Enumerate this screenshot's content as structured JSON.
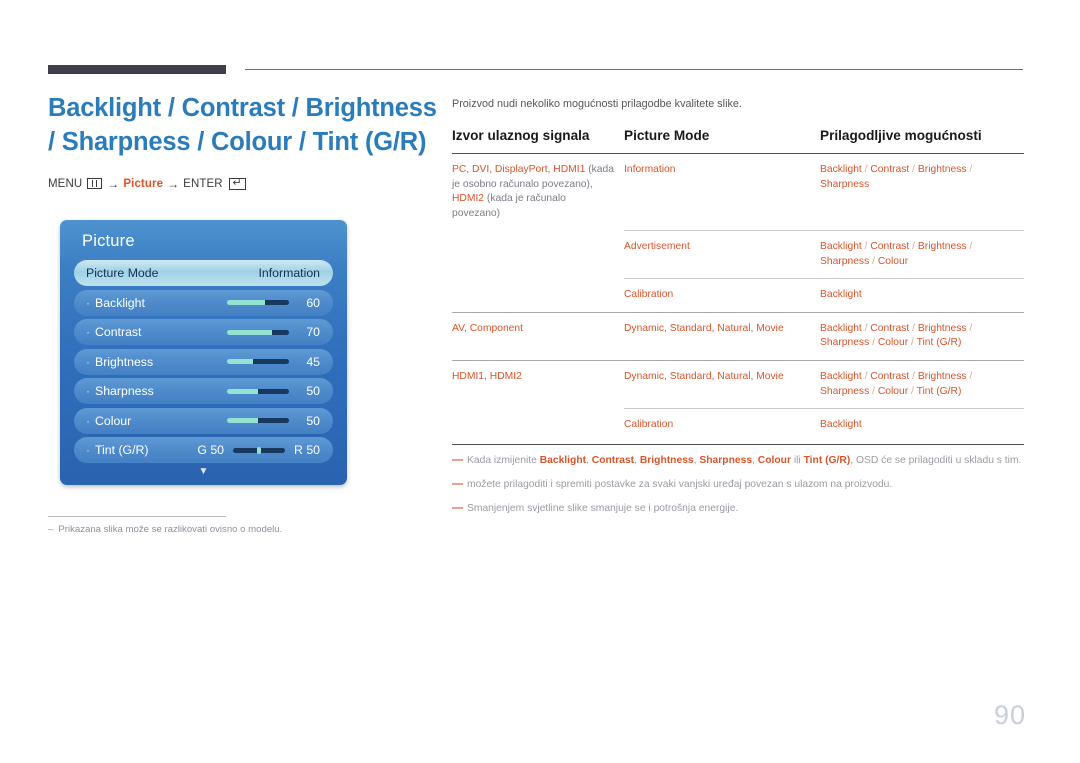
{
  "page": {
    "number": "90"
  },
  "left": {
    "title": "Backlight / Contrast / Brightness / Sharpness / Colour / Tint (G/R)",
    "menu_path": {
      "menu_label": "MENU",
      "menu_icon": "menu-bars-icon",
      "arrow1": "→",
      "target": "Picture",
      "arrow2": "→",
      "enter_label": "ENTER",
      "enter_icon": "enter-key-icon",
      "enter_glyph": "↵"
    },
    "note": {
      "dash": "–",
      "text": "Prikazana slika može se razlikovati ovisno o modelu."
    }
  },
  "osd": {
    "title": "Picture",
    "more_arrow": "▼",
    "bullet": "·",
    "rows": [
      {
        "name": "picture-mode",
        "label": "Picture Mode",
        "value": "Information",
        "type": "select",
        "selected": true
      },
      {
        "name": "backlight",
        "label": "Backlight",
        "value": "60",
        "type": "slider",
        "fill_percent": 62,
        "selected": false
      },
      {
        "name": "contrast",
        "label": "Contrast",
        "value": "70",
        "type": "slider",
        "fill_percent": 72,
        "selected": false
      },
      {
        "name": "brightness",
        "label": "Brightness",
        "value": "45",
        "type": "slider",
        "fill_percent": 42,
        "selected": false
      },
      {
        "name": "sharpness",
        "label": "Sharpness",
        "value": "50",
        "type": "slider",
        "fill_percent": 50,
        "selected": false
      },
      {
        "name": "colour",
        "label": "Colour",
        "value": "50",
        "type": "slider",
        "fill_percent": 50,
        "selected": false
      },
      {
        "name": "tint",
        "label": "Tint (G/R)",
        "left_value": "G 50",
        "value": "R 50",
        "type": "tint",
        "selected": false
      }
    ]
  },
  "right": {
    "intro": "Proizvod nudi nekoliko mogućnosti prilagodbe kvalitete slike.",
    "table": {
      "headers": [
        "Izvor ulaznog signala",
        "Picture Mode",
        "Prilagodljive mogućnosti"
      ],
      "groups": [
        {
          "source_accent": "PC, DVI, DisplayPort, HDMI1",
          "source_note1": " (kada je osobno računalo povezano), ",
          "source_accent2": "HDMI2",
          "source_note2": " (kada je računalo povezano)",
          "rows": [
            {
              "mode": "Information",
              "options": "Backlight / Contrast / Brightness / Sharpness"
            },
            {
              "mode": "Advertisement",
              "options": "Backlight / Contrast / Brightness / Sharpness / Colour"
            },
            {
              "mode": "Calibration",
              "options": "Backlight"
            }
          ]
        },
        {
          "source_accent": "AV, Component",
          "source_note1": "",
          "source_accent2": "",
          "source_note2": "",
          "rows": [
            {
              "mode": "Dynamic, Standard, Natural, Movie",
              "options": "Backlight / Contrast / Brightness / Sharpness / Colour / Tint (G/R)"
            }
          ]
        },
        {
          "source_accent": "HDMI1, HDMI2",
          "source_note1": "",
          "source_accent2": "",
          "source_note2": "",
          "rows": [
            {
              "mode": "Dynamic, Standard, Natural, Movie",
              "options": "Backlight / Contrast / Brightness / Sharpness / Colour / Tint (G/R)"
            },
            {
              "mode": "Calibration",
              "options": "Backlight"
            }
          ]
        }
      ]
    },
    "footnotes": [
      {
        "dash": "—",
        "parts": [
          {
            "t": "Kada izmijenite ",
            "accent": false
          },
          {
            "t": "Backlight",
            "accent": true
          },
          {
            "t": ", ",
            "accent": false
          },
          {
            "t": "Contrast",
            "accent": true
          },
          {
            "t": ", ",
            "accent": false
          },
          {
            "t": "Brightness",
            "accent": true
          },
          {
            "t": ", ",
            "accent": false
          },
          {
            "t": "Sharpness",
            "accent": true
          },
          {
            "t": ", ",
            "accent": false
          },
          {
            "t": "Colour",
            "accent": true
          },
          {
            "t": "  ili ",
            "accent": false
          },
          {
            "t": "Tint (G/R)",
            "accent": true
          },
          {
            "t": ", OSD će se prilagoditi u skladu s tim.",
            "accent": false
          }
        ]
      },
      {
        "dash": "—",
        "parts": [
          {
            "t": "možete prilagoditi i spremiti postavke za svaki vanjski uređaj povezan s ulazom na proizvodu.",
            "accent": false
          }
        ]
      },
      {
        "dash": "—",
        "parts": [
          {
            "t": "Smanjenjem svjetline slike smanjuje se i potrošnja energije.",
            "accent": false
          }
        ]
      }
    ]
  },
  "colors": {
    "title_blue": "#2b7cba",
    "accent_orange": "#d9542b",
    "rule_dark": "#413d4b",
    "osd_blue": "#2f6ebb",
    "page_number_grey": "#c9cfd8"
  }
}
